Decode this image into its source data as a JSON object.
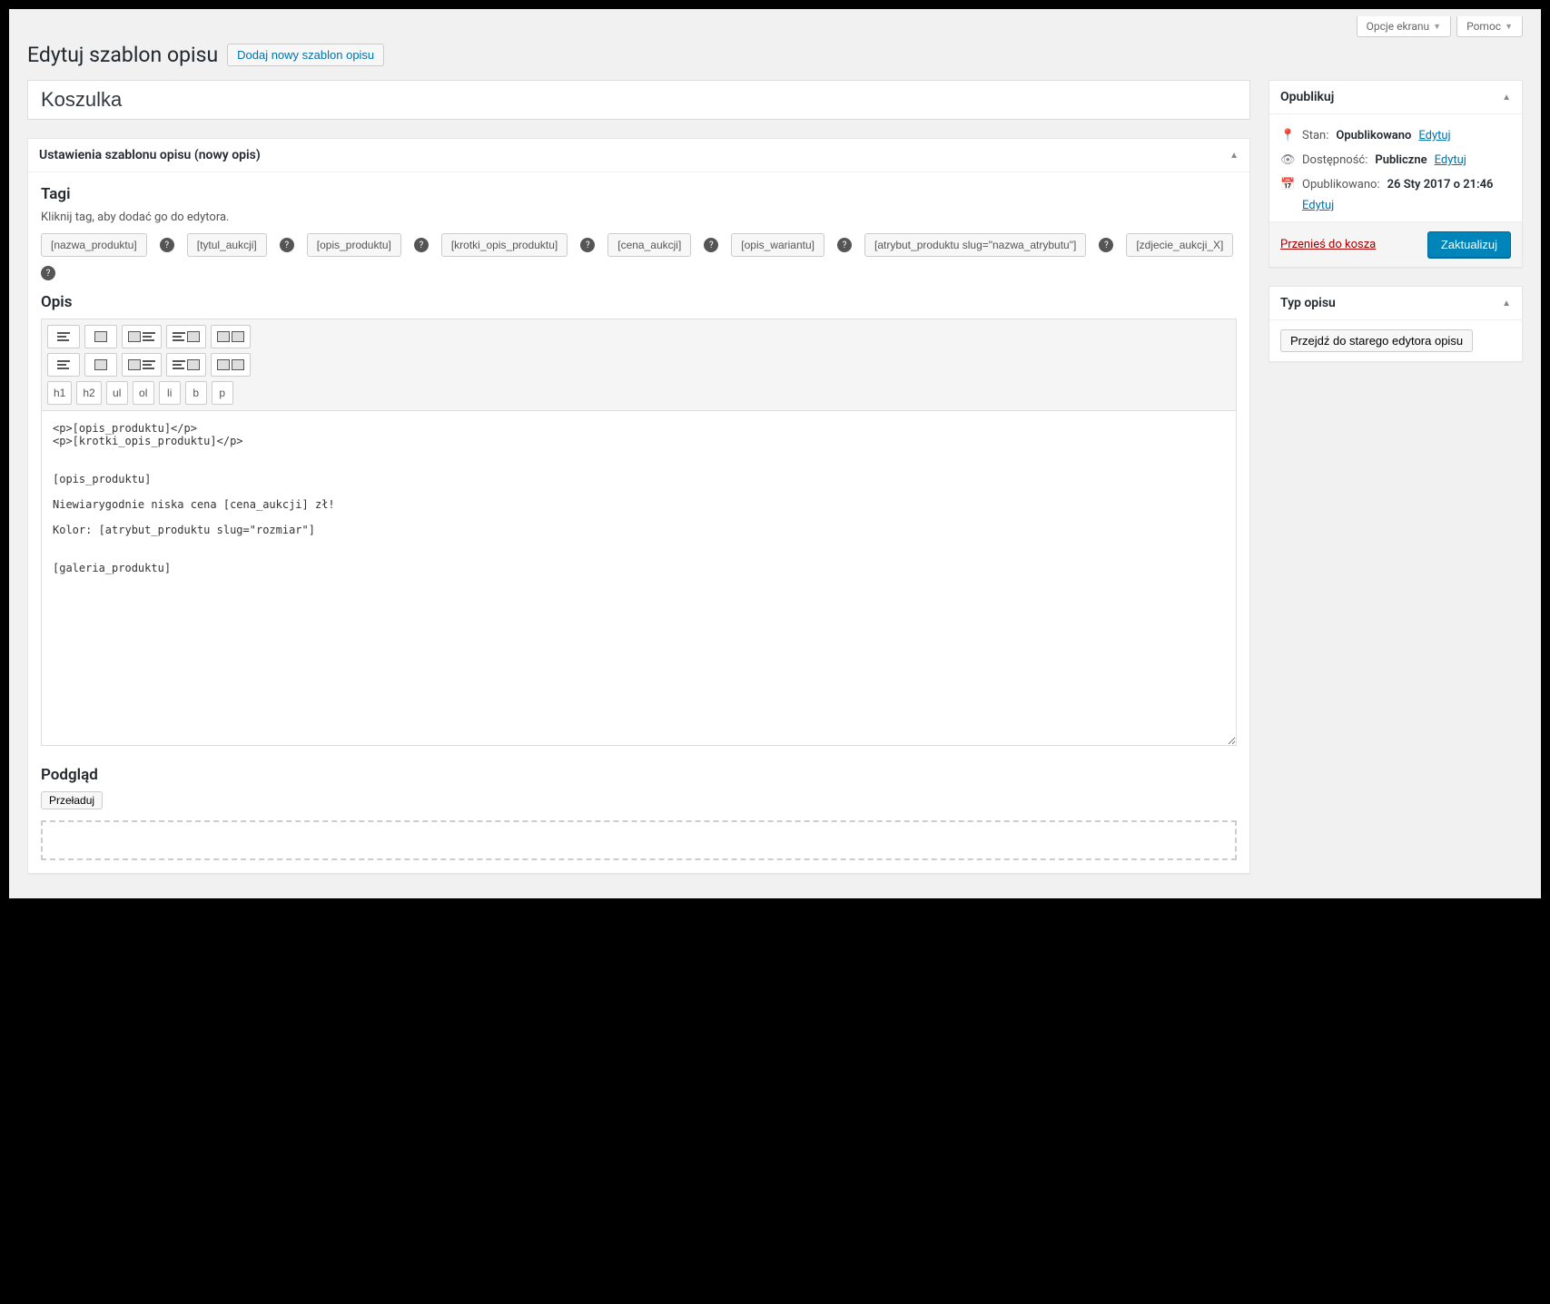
{
  "top": {
    "screen_options": "Opcje ekranu",
    "help": "Pomoc"
  },
  "heading": {
    "title": "Edytuj szablon opisu",
    "add_new": "Dodaj nowy szablon opisu"
  },
  "title_input": "Koszulka",
  "settings_box": {
    "title": "Ustawienia szablonu opisu (nowy opis)"
  },
  "tags_section": {
    "heading": "Tagi",
    "hint": "Kliknij tag, aby dodać go do edytora.",
    "tags": [
      "[nazwa_produktu]",
      "[tytul_aukcji]",
      "[opis_produktu]",
      "[krotki_opis_produktu]",
      "[cena_aukcji]",
      "[opis_wariantu]",
      "[atrybut_produktu slug=\"nazwa_atrybutu\"]",
      "[zdjecie_aukcji_X]"
    ]
  },
  "desc_section": {
    "heading": "Opis",
    "txtbuttons": [
      "h1",
      "h2",
      "ul",
      "ol",
      "li",
      "b",
      "p"
    ],
    "content": "<p>[opis_produktu]</p>\n<p>[krotki_opis_produktu]</p>\n\n\n[opis_produktu]\n\nNiewiarygodnie niska cena [cena_aukcji] zł!\n\nKolor: [atrybut_produktu slug=\"rozmiar\"]\n\n\n[galeria_produktu]"
  },
  "preview_section": {
    "heading": "Podgląd",
    "reload": "Przeładuj"
  },
  "publish": {
    "box_title": "Opublikuj",
    "status_label": "Stan:",
    "status_value": "Opublikowano",
    "visibility_label": "Dostępność:",
    "visibility_value": "Publiczne",
    "published_label": "Opublikowano:",
    "published_value": "26 Sty 2017 o 21:46",
    "edit": "Edytuj",
    "trash": "Przenieś do kosza",
    "update": "Zaktualizuj"
  },
  "type_box": {
    "title": "Typ opisu",
    "button": "Przejdź do starego edytora opisu"
  }
}
